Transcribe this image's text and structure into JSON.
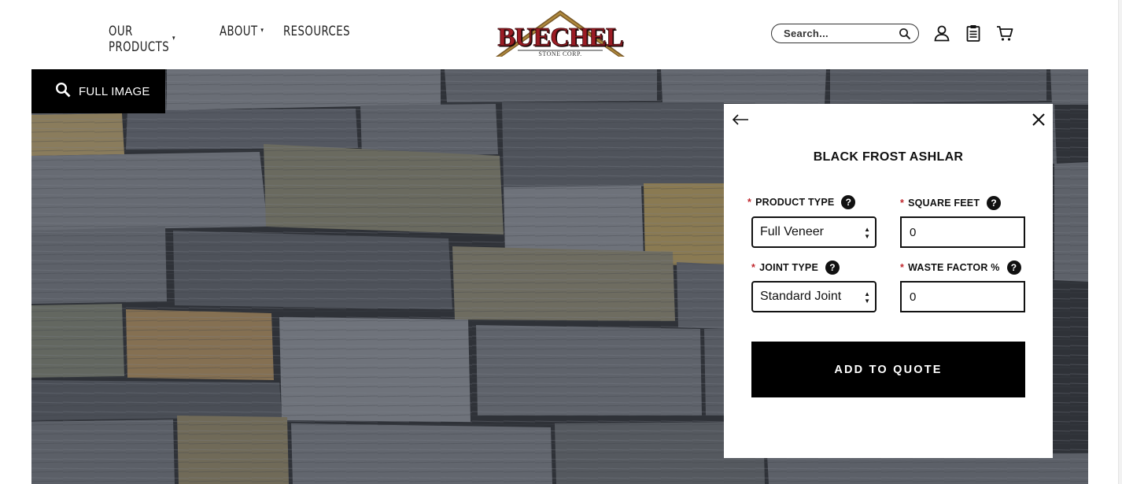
{
  "nav": {
    "items": [
      {
        "label": "OUR PRODUCTS",
        "has_dropdown": true
      },
      {
        "label": "ABOUT",
        "has_dropdown": true
      },
      {
        "label": "RESOURCES",
        "has_dropdown": false
      }
    ],
    "caret": "▾"
  },
  "logo": {
    "name": "BUECHEL",
    "tagline": "STONE CORP."
  },
  "header": {
    "search_placeholder": "Search...",
    "icons": [
      "search-icon",
      "account-icon",
      "quote-clipboard-icon",
      "cart-icon"
    ]
  },
  "hero": {
    "full_image_label": "FULL IMAGE"
  },
  "panel": {
    "title": "BLACK FROST ASHLAR",
    "required_mark": "*",
    "help_glyph": "?",
    "product_type": {
      "label": "PRODUCT TYPE",
      "value": "Full Veneer"
    },
    "square_feet": {
      "label": "SQUARE FEET",
      "value": "0"
    },
    "joint_type": {
      "label": "JOINT TYPE",
      "value": "Standard Joint"
    },
    "waste_factor": {
      "label": "WASTE FACTOR %",
      "value": "0"
    },
    "add_button": "ADD TO QUOTE"
  },
  "colors": {
    "required": "#c0272d",
    "logo_red": "#8e1b22",
    "logo_gold": "#b08a3c",
    "button": "#000000"
  }
}
